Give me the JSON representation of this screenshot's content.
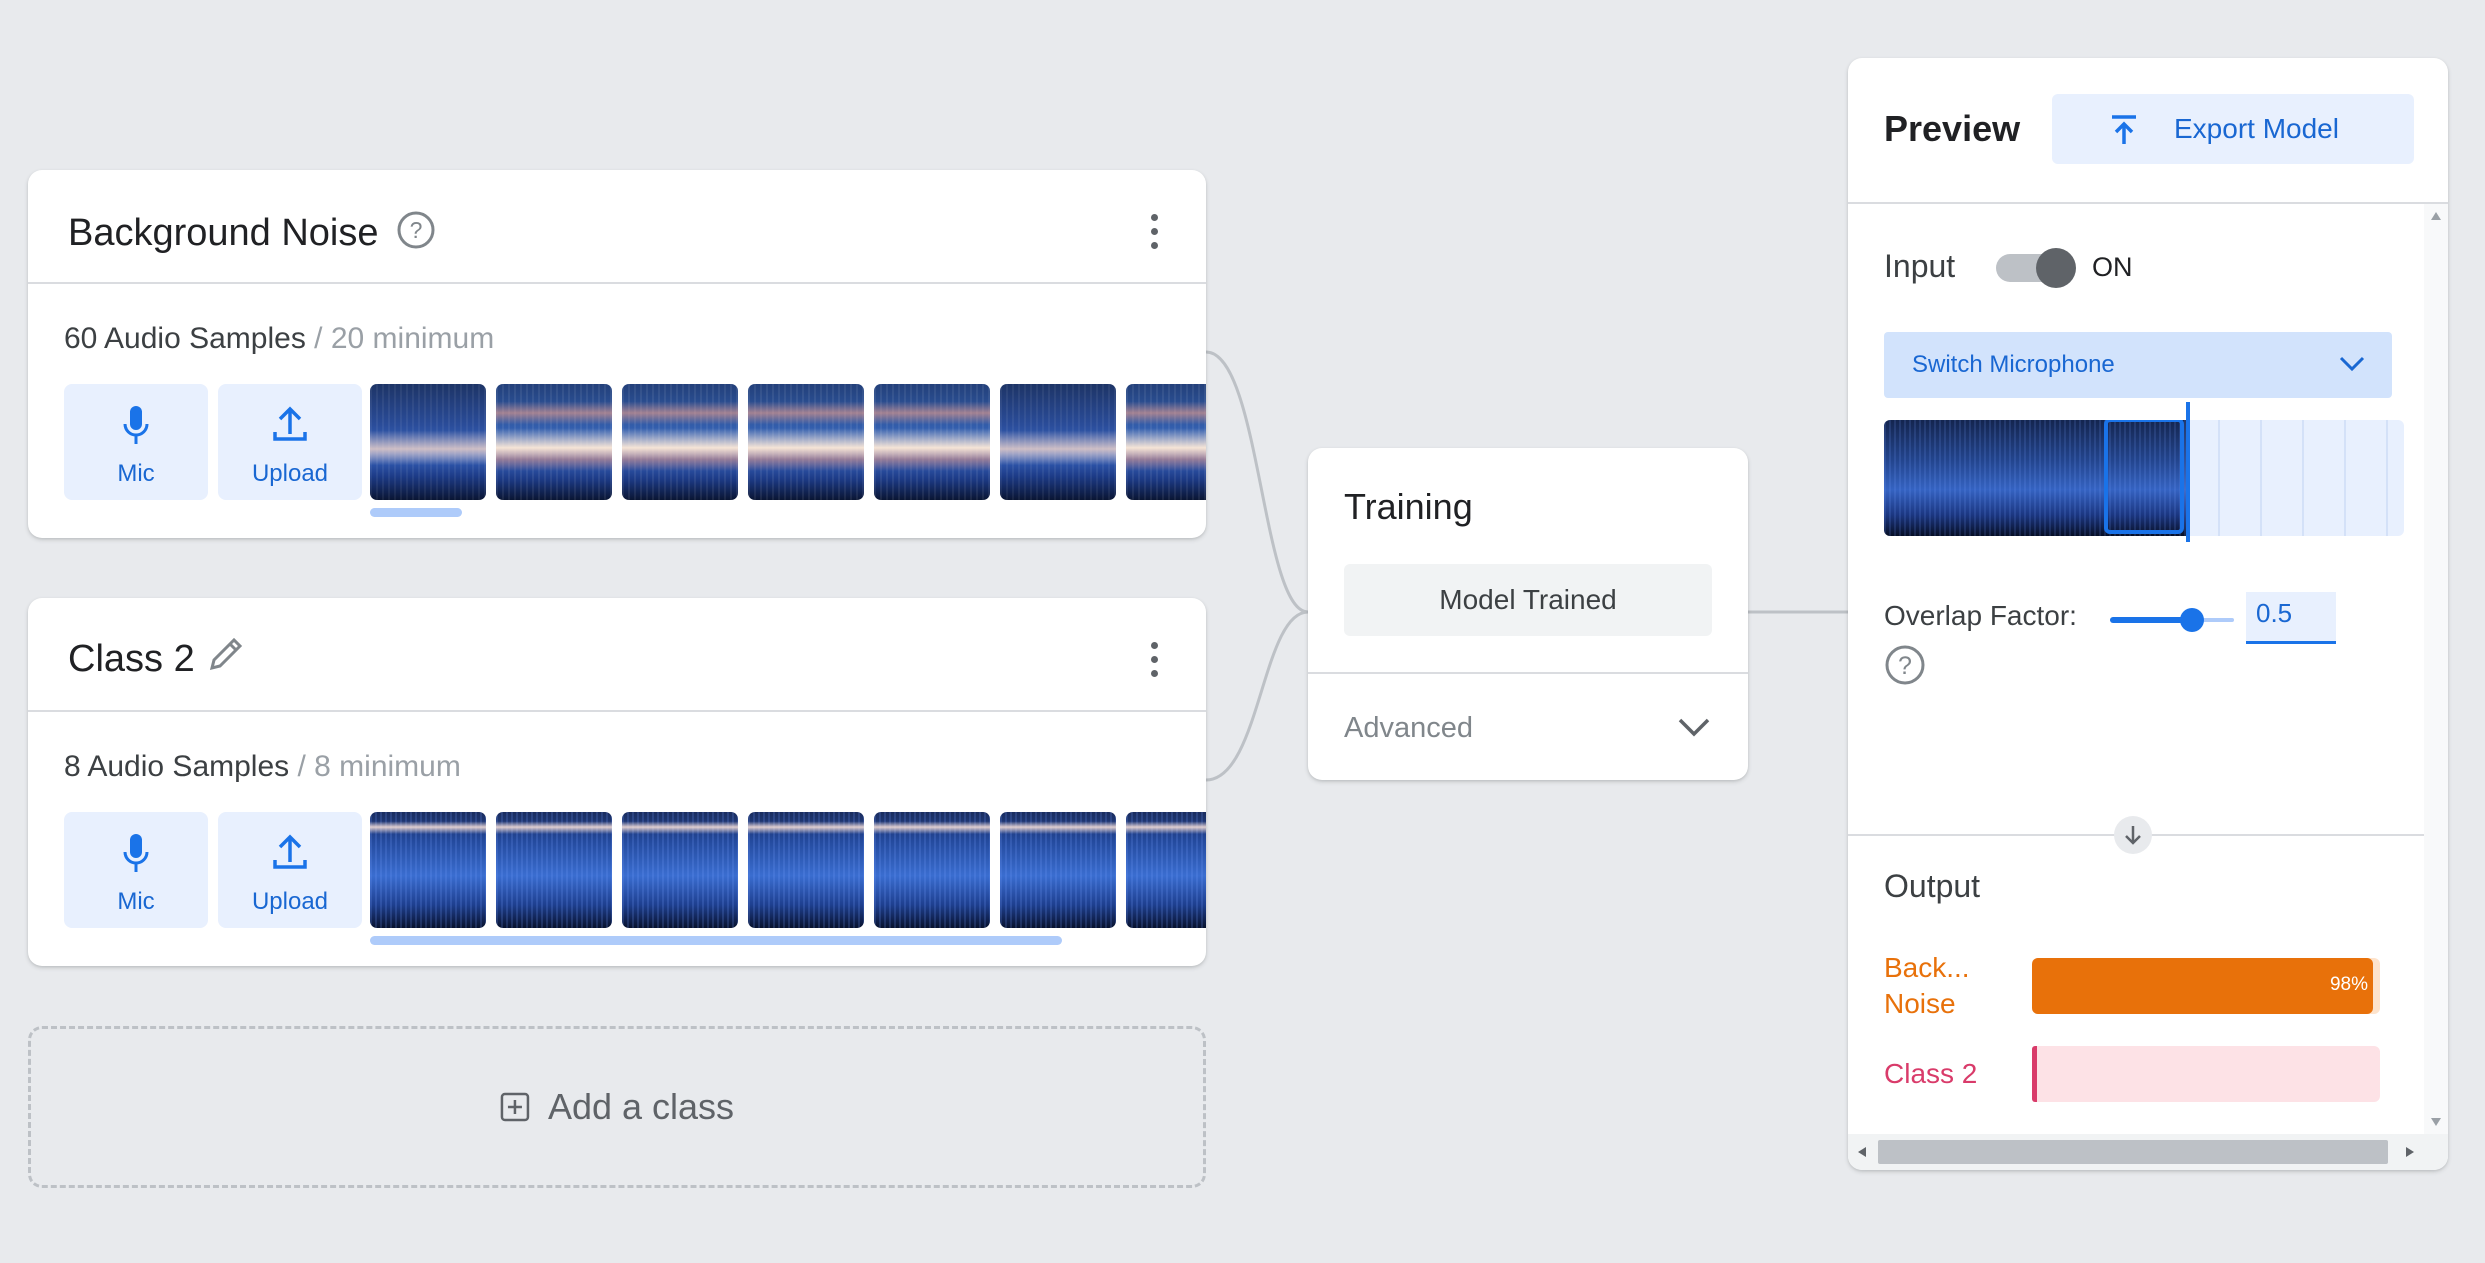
{
  "classes": [
    {
      "name": "Background Noise",
      "sample_count": "60 Audio Samples",
      "minimum": " / 20 minimum",
      "mic_label": "Mic",
      "upload_label": "Upload",
      "title_icon": "help-icon"
    },
    {
      "name": "Class 2",
      "sample_count": "8 Audio Samples",
      "minimum": " / 8 minimum",
      "mic_label": "Mic",
      "upload_label": "Upload",
      "title_icon": "edit-pencil-icon"
    }
  ],
  "add_class": {
    "label": "Add a class"
  },
  "training": {
    "title": "Training",
    "status_button": "Model Trained",
    "advanced_label": "Advanced"
  },
  "preview": {
    "title": "Preview",
    "export_label": "Export Model",
    "input_label": "Input",
    "toggle_state": "ON",
    "microphone_select": "Switch Microphone",
    "overlap_label": "Overlap Factor:",
    "overlap_value": "0.5",
    "output_label": "Output",
    "outputs": [
      {
        "label": "Back...\nNoise",
        "percent": 98,
        "percent_text": "98%",
        "color": "#e8710a",
        "track_color": "#fde3cc"
      },
      {
        "label": "Class 2",
        "percent": 1,
        "percent_text": "",
        "color": "#d01884",
        "track_color": "#fde2e6"
      }
    ]
  },
  "colors": {
    "accent": "#1a73e8",
    "background": "#e8eaed"
  }
}
